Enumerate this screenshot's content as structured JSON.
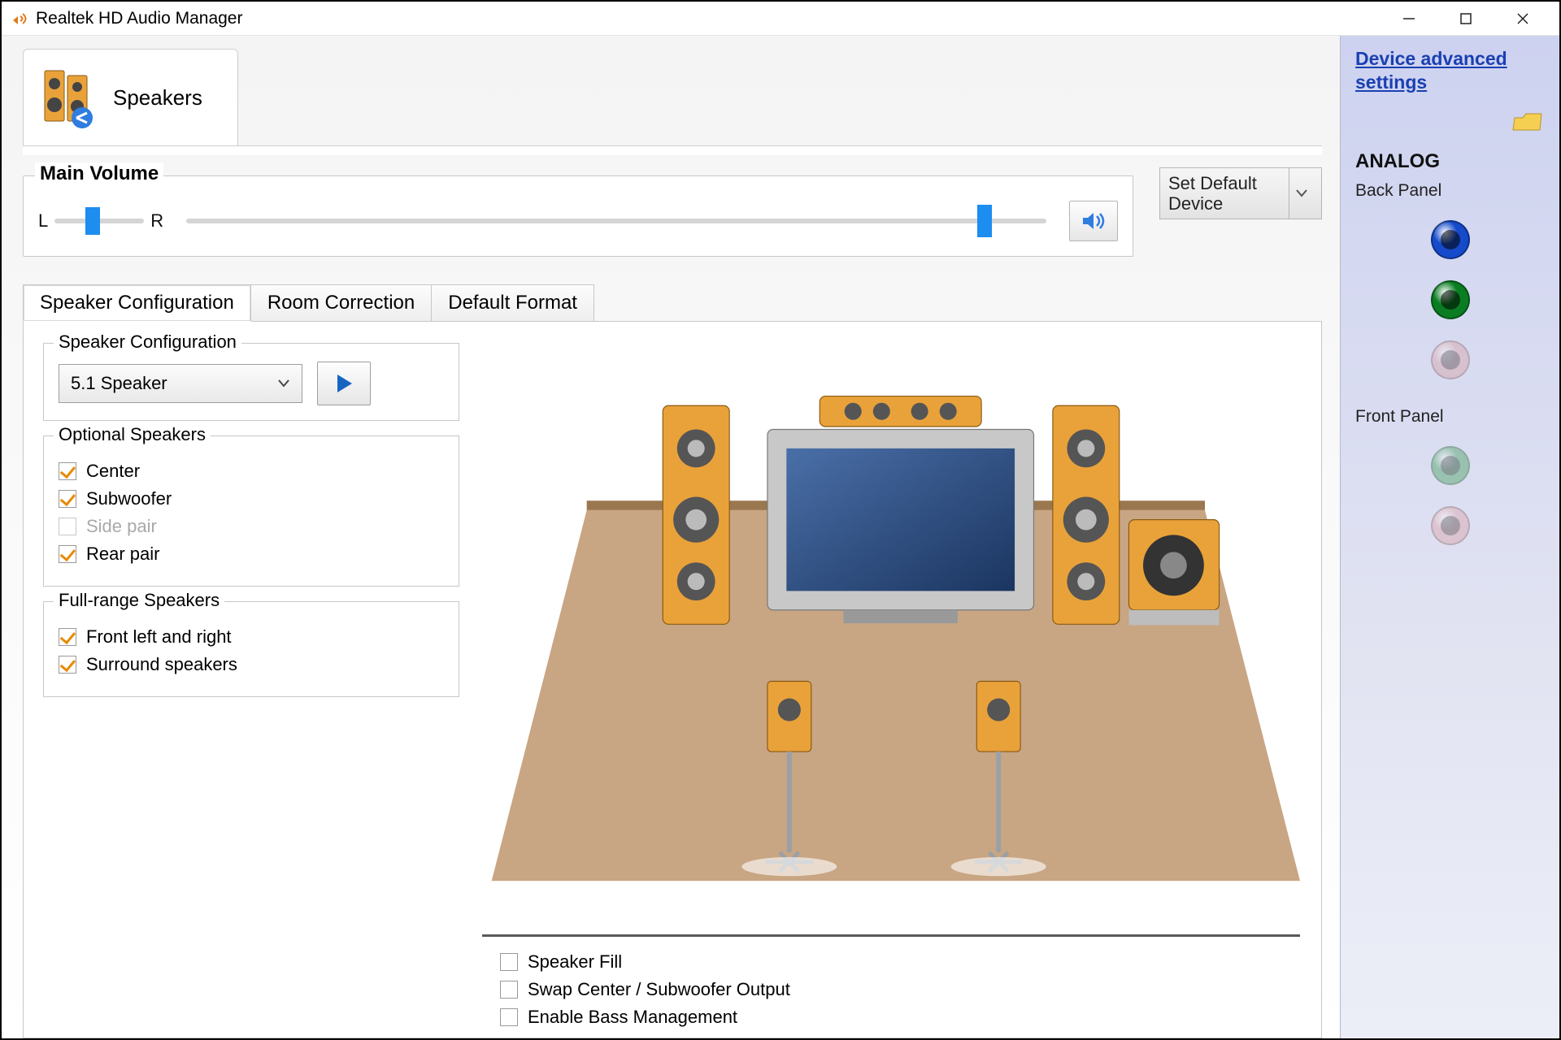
{
  "titlebar": {
    "title": "Realtek HD Audio Manager"
  },
  "device_tab": {
    "label": "Speakers"
  },
  "volume": {
    "group_label": "Main Volume",
    "left_label": "L",
    "right_label": "R",
    "balance_percent": 34,
    "master_percent": 92,
    "set_default_label": "Set Default Device"
  },
  "subtabs": {
    "speaker_config": "Speaker Configuration",
    "room_correction": "Room Correction",
    "default_format": "Default Format"
  },
  "config": {
    "group_label": "Speaker Configuration",
    "selected": "5.1 Speaker"
  },
  "optional": {
    "group_label": "Optional Speakers",
    "center": "Center",
    "subwoofer": "Subwoofer",
    "side_pair": "Side pair",
    "rear_pair": "Rear pair"
  },
  "fullrange": {
    "group_label": "Full-range Speakers",
    "front_lr": "Front left and right",
    "surround": "Surround speakers"
  },
  "bottom": {
    "speaker_fill": "Speaker Fill",
    "swap": "Swap Center / Subwoofer Output",
    "bass": "Enable Bass Management"
  },
  "sidebar": {
    "adv_link": "Device advanced settings",
    "analog_title": "ANALOG",
    "back_panel": "Back Panel",
    "front_panel": "Front Panel",
    "back_jacks": [
      {
        "name": "line-in-jack",
        "color": "#154acb",
        "dim": false
      },
      {
        "name": "line-out-jack",
        "color": "#0a7d22",
        "dim": false
      },
      {
        "name": "mic-jack",
        "color": "#d9a2a6",
        "dim": true
      }
    ],
    "front_jacks": [
      {
        "name": "front-headphone-jack",
        "color": "#4aa062",
        "dim": true
      },
      {
        "name": "front-mic-jack",
        "color": "#d9a2a6",
        "dim": true
      }
    ]
  }
}
